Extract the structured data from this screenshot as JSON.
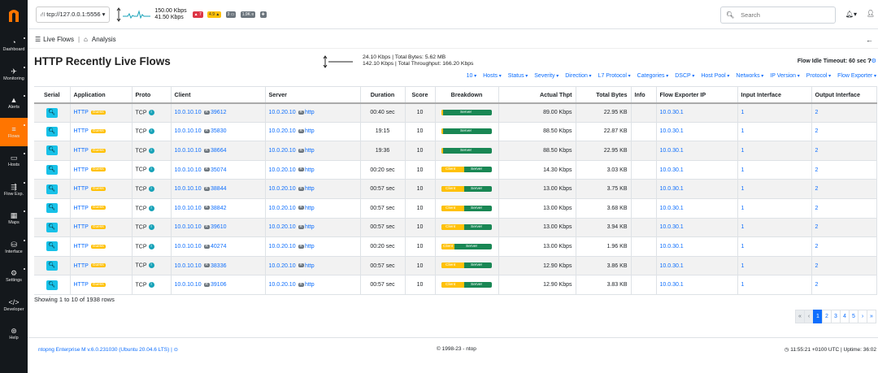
{
  "sidebar": {
    "logo": "n",
    "items": [
      {
        "icon": "◔",
        "label": "Dashboard"
      },
      {
        "icon": "✈",
        "label": "Monitoring"
      },
      {
        "icon": "▲",
        "label": "Alerts"
      },
      {
        "icon": "≡",
        "label": "Flows"
      },
      {
        "icon": "▭",
        "label": "Hosts"
      },
      {
        "icon": "⇶",
        "label": "Flow Exp."
      },
      {
        "icon": "▦",
        "label": "Maps"
      },
      {
        "icon": "⛁",
        "label": "Interface"
      },
      {
        "icon": "⚙",
        "label": "Settings"
      },
      {
        "icon": "</>",
        "label": "Developer"
      },
      {
        "icon": "⊛",
        "label": "Help"
      }
    ],
    "active_index": 3
  },
  "topbar": {
    "interface": "tcp://127.0.0.1:5556",
    "upload_rate": "150.00 Kbps",
    "download_rate": "41.50 Kbps",
    "badges": [
      "7",
      "4.9",
      "3",
      "1.9K"
    ],
    "search_placeholder": "Search"
  },
  "breadcrumb": {
    "section": "Live Flows",
    "page": "Analysis"
  },
  "page": {
    "title": "HTTP Recently Live Flows",
    "live_line1": "24.10 Kbps | Total Bytes: 5.62 MB",
    "live_line2": "142.10 Kbps | Total Throughput: 166.20 Kbps",
    "idle_timeout": "Flow Idle Timeout: 60 sec"
  },
  "filters": [
    "10",
    "Hosts",
    "Status",
    "Severity",
    "Direction",
    "L7 Protocol",
    "Categories",
    "DSCP",
    "Host Pool",
    "Networks",
    "IP Version",
    "Protocol",
    "Flow Exporter"
  ],
  "table": {
    "columns": [
      "Serial",
      "Application",
      "Proto",
      "Client",
      "Server",
      "Duration",
      "Score",
      "Breakdown",
      "Actual Thpt",
      "Total Bytes",
      "Info",
      "Flow Exporter IP",
      "Input Interface",
      "Output Interface"
    ],
    "rows": [
      {
        "app": "HTTP",
        "proto": "TCP",
        "client_ip": "10.0.10.10",
        "client_port": "39612",
        "server_ip": "10.0.20.10",
        "server_port": "http",
        "duration": "00:40 sec",
        "score": "10",
        "client_pct": 4,
        "thpt": "89.00 Kbps",
        "bytes": "22.95 KB",
        "exporter": "10.0.30.1",
        "in_if": "1",
        "out_if": "2"
      },
      {
        "app": "HTTP",
        "proto": "TCP",
        "client_ip": "10.0.10.10",
        "client_port": "35830",
        "server_ip": "10.0.20.10",
        "server_port": "http",
        "duration": "19:15",
        "score": "10",
        "client_pct": 4,
        "thpt": "88.50 Kbps",
        "bytes": "22.87 KB",
        "exporter": "10.0.30.1",
        "in_if": "1",
        "out_if": "2"
      },
      {
        "app": "HTTP",
        "proto": "TCP",
        "client_ip": "10.0.10.10",
        "client_port": "38664",
        "server_ip": "10.0.20.10",
        "server_port": "http",
        "duration": "19:36",
        "score": "10",
        "client_pct": 4,
        "thpt": "88.50 Kbps",
        "bytes": "22.95 KB",
        "exporter": "10.0.30.1",
        "in_if": "1",
        "out_if": "2"
      },
      {
        "app": "HTTP",
        "proto": "TCP",
        "client_ip": "10.0.10.10",
        "client_port": "35074",
        "server_ip": "10.0.20.10",
        "server_port": "http",
        "duration": "00:20 sec",
        "score": "10",
        "client_pct": 45,
        "thpt": "14.30 Kbps",
        "bytes": "3.03 KB",
        "exporter": "10.0.30.1",
        "in_if": "1",
        "out_if": "2"
      },
      {
        "app": "HTTP",
        "proto": "TCP",
        "client_ip": "10.0.10.10",
        "client_port": "38844",
        "server_ip": "10.0.20.10",
        "server_port": "http",
        "duration": "00:57 sec",
        "score": "10",
        "client_pct": 45,
        "thpt": "13.00 Kbps",
        "bytes": "3.75 KB",
        "exporter": "10.0.30.1",
        "in_if": "1",
        "out_if": "2"
      },
      {
        "app": "HTTP",
        "proto": "TCP",
        "client_ip": "10.0.10.10",
        "client_port": "38842",
        "server_ip": "10.0.20.10",
        "server_port": "http",
        "duration": "00:57 sec",
        "score": "10",
        "client_pct": 45,
        "thpt": "13.00 Kbps",
        "bytes": "3.68 KB",
        "exporter": "10.0.30.1",
        "in_if": "1",
        "out_if": "2"
      },
      {
        "app": "HTTP",
        "proto": "TCP",
        "client_ip": "10.0.10.10",
        "client_port": "39610",
        "server_ip": "10.0.20.10",
        "server_port": "http",
        "duration": "00:57 sec",
        "score": "10",
        "client_pct": 45,
        "thpt": "13.00 Kbps",
        "bytes": "3.94 KB",
        "exporter": "10.0.30.1",
        "in_if": "1",
        "out_if": "2"
      },
      {
        "app": "HTTP",
        "proto": "TCP",
        "client_ip": "10.0.10.10",
        "client_port": "40274",
        "server_ip": "10.0.20.10",
        "server_port": "http",
        "duration": "00:20 sec",
        "score": "10",
        "client_pct": 25,
        "thpt": "13.00 Kbps",
        "bytes": "1.96 KB",
        "exporter": "10.0.30.1",
        "in_if": "1",
        "out_if": "2"
      },
      {
        "app": "HTTP",
        "proto": "TCP",
        "client_ip": "10.0.10.10",
        "client_port": "38336",
        "server_ip": "10.0.20.10",
        "server_port": "http",
        "duration": "00:57 sec",
        "score": "10",
        "client_pct": 45,
        "thpt": "12.90 Kbps",
        "bytes": "3.86 KB",
        "exporter": "10.0.30.1",
        "in_if": "1",
        "out_if": "2"
      },
      {
        "app": "HTTP",
        "proto": "TCP",
        "client_ip": "10.0.10.10",
        "client_port": "39106",
        "server_ip": "10.0.20.10",
        "server_port": "http",
        "duration": "00:57 sec",
        "score": "10",
        "client_pct": 45,
        "thpt": "12.90 Kbps",
        "bytes": "3.83 KB",
        "exporter": "10.0.30.1",
        "in_if": "1",
        "out_if": "2"
      }
    ],
    "guess_label": "Guess",
    "bar_client": "Client",
    "bar_server": "Server"
  },
  "showing": "Showing 1 to 10 of 1938 rows",
  "pagination": [
    "«",
    "‹",
    "1",
    "2",
    "3",
    "4",
    "5",
    "›",
    "»"
  ],
  "footer": {
    "left": "ntopng Enterprise M v.6.0.231030 (Ubuntu 20.04.6 LTS) |",
    "center": "© 1998-23 - ntop",
    "right": "11:55:21 +0100 UTC | Uptime: 36:02"
  },
  "colors": {
    "brand": "#ff7500",
    "link": "#0d6efd",
    "server_bar": "#198754",
    "client_bar": "#ffc107",
    "serial_btn": "#17c1e8"
  }
}
